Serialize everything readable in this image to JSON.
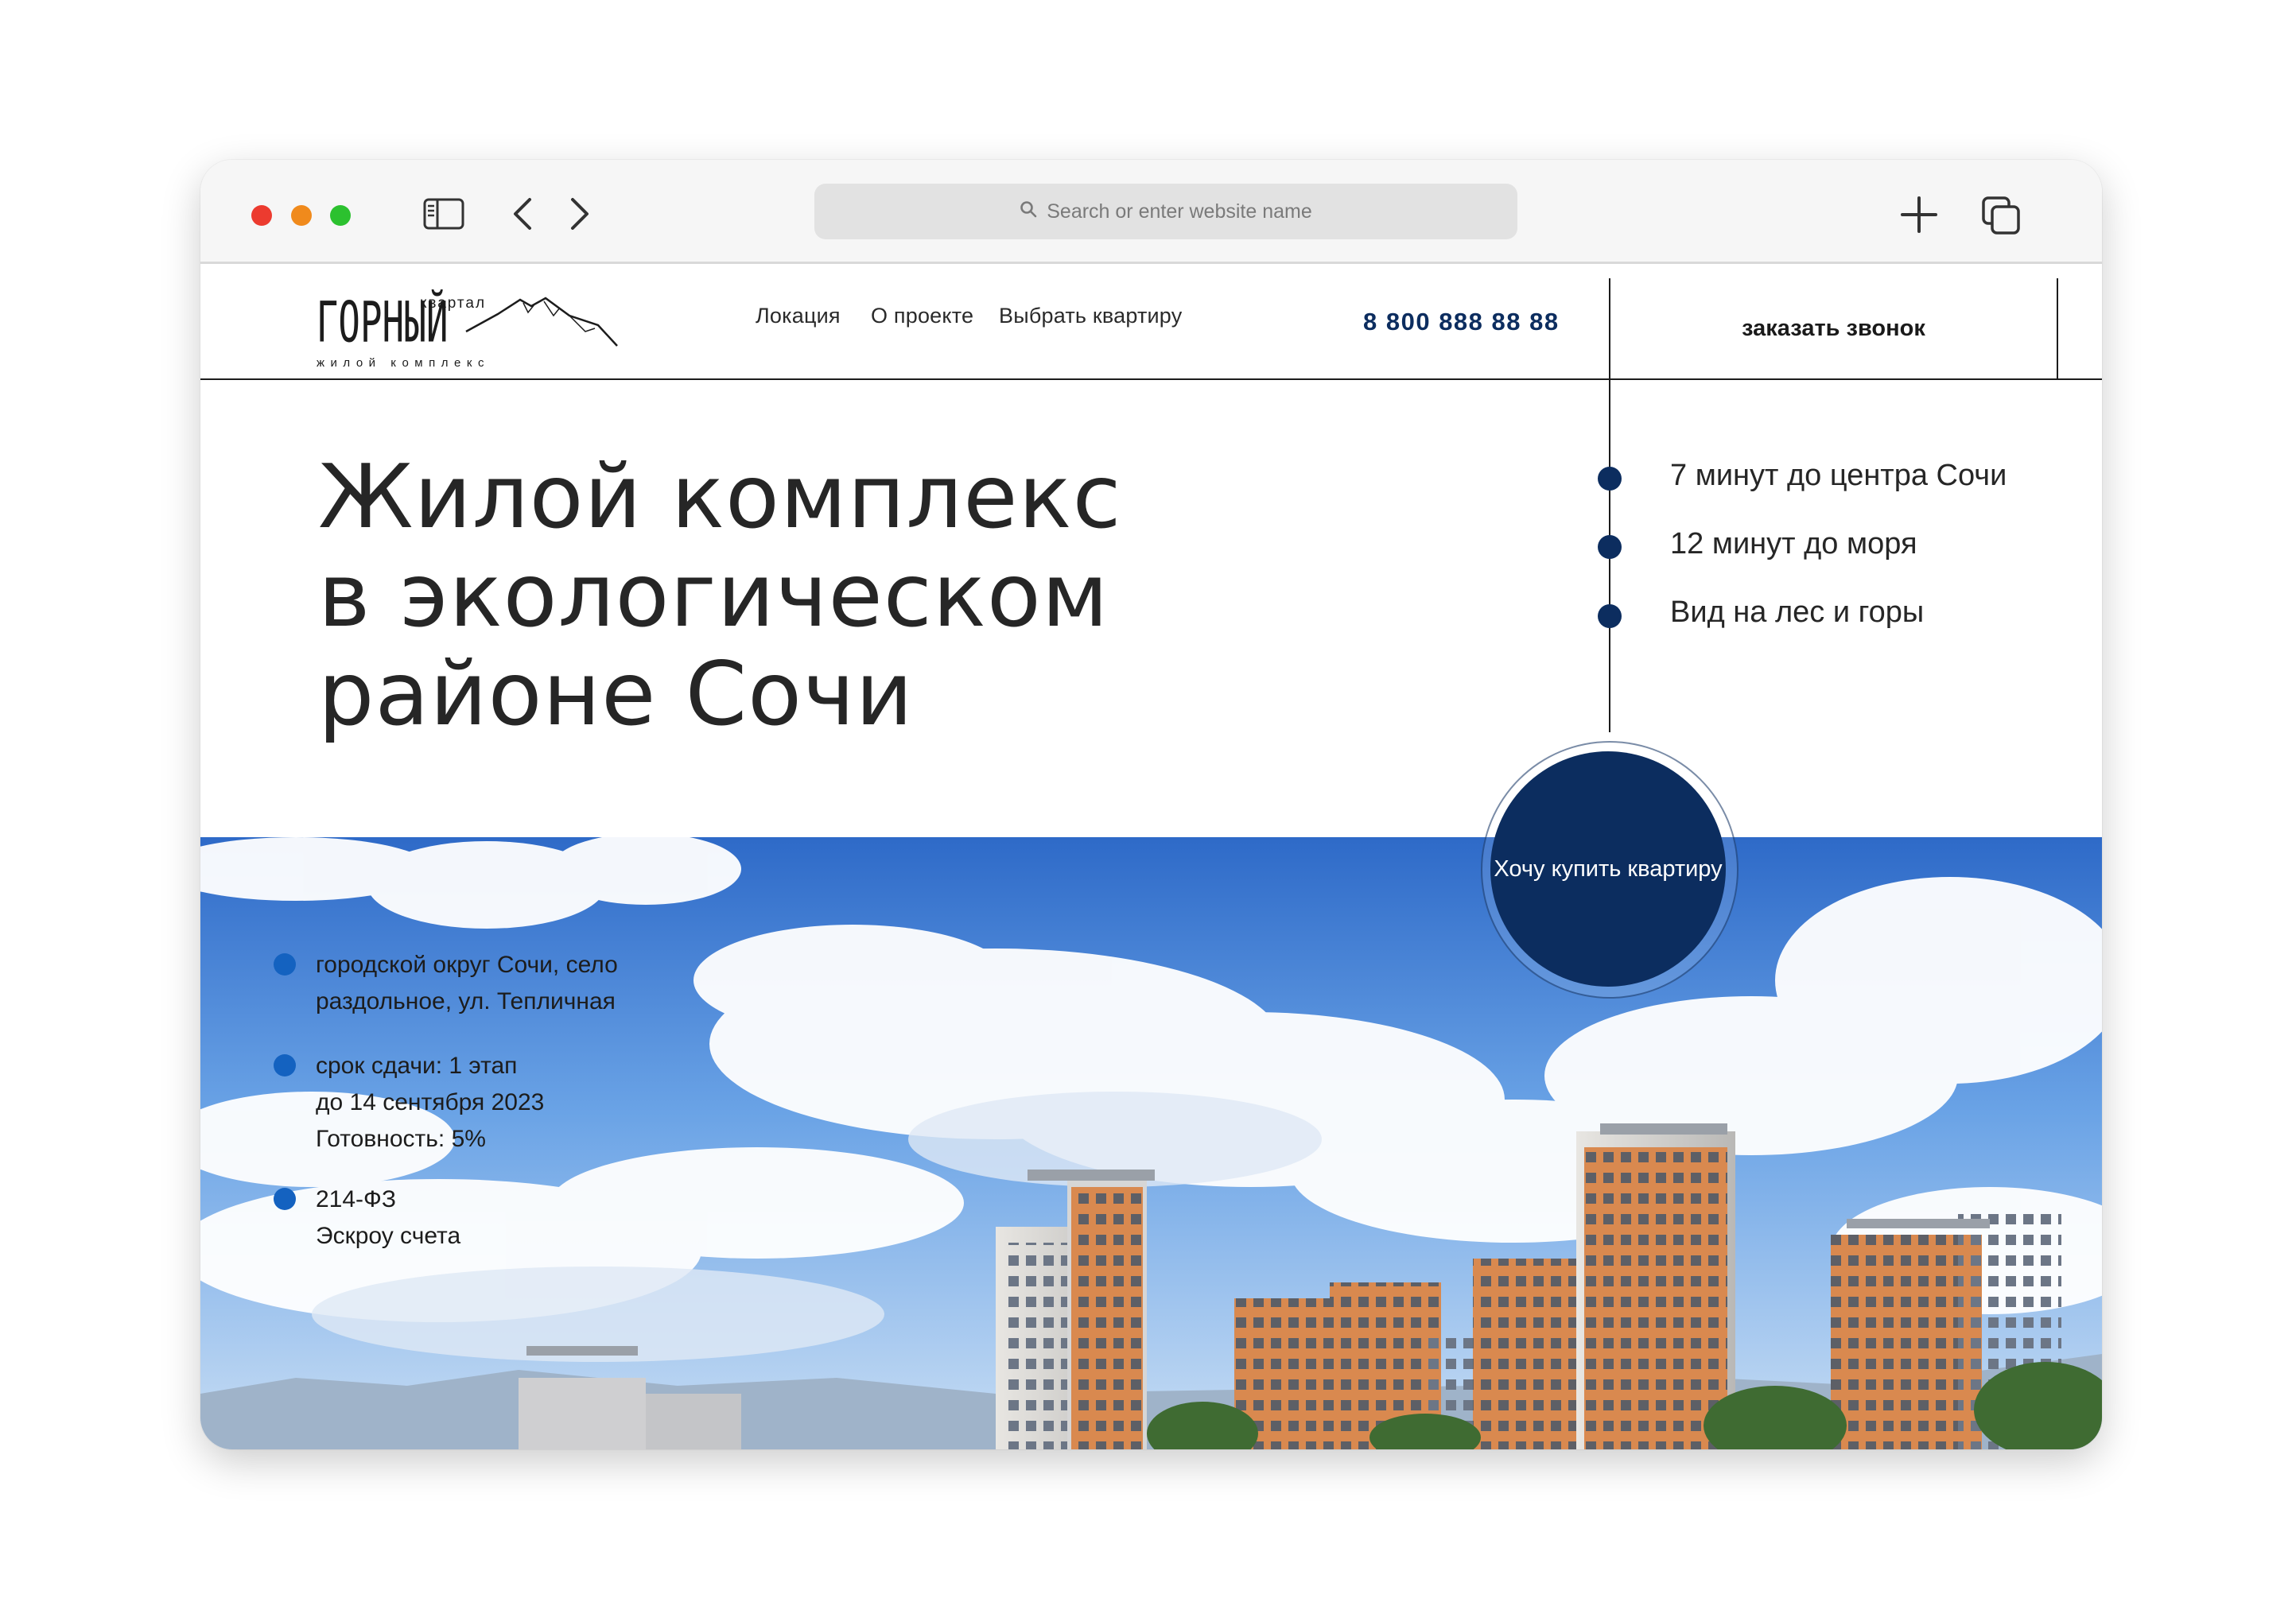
{
  "browser": {
    "address_placeholder": "Search or enter website name",
    "icons": [
      "sidebar-icon",
      "chevron-left-icon",
      "chevron-right-icon",
      "search-icon",
      "plus-icon",
      "tabs-icon"
    ]
  },
  "header": {
    "logo": {
      "name_text": "ГОРНЫЙ",
      "kvartal_text": "квартал",
      "tagline_text": "жилой комплекс"
    },
    "nav": [
      "Локация",
      "О проекте",
      "Выбрать квартиру"
    ],
    "phone": "8 800 888 88 88",
    "callback_label": "заказать звонок"
  },
  "hero": {
    "title_lines": [
      "Жилой комплекс",
      "в экологическом",
      "районе Сочи"
    ],
    "features": [
      "7 минут до центра Сочи",
      "12 минут до моря",
      "Вид на лес и горы"
    ],
    "cta_label": "Хочу купить квартиру"
  },
  "info": {
    "items": [
      {
        "lines": [
          "городской округ Сочи, село",
          "раздольное, ул. Тепличная"
        ]
      },
      {
        "lines": [
          "срок сдачи: 1 этап",
          "до 14 сентября 2023",
          "Готовность: 5%"
        ]
      },
      {
        "lines": [
          "214-ФЗ",
          "Эскроу счета"
        ]
      }
    ]
  },
  "colors": {
    "brand_navy": "#0c2d5f",
    "accent_blue": "#1462c0",
    "text_dark": "#262626",
    "traffic_red": "#ec3b2f",
    "traffic_yellow": "#f08a1c",
    "traffic_green": "#2cc12f"
  }
}
